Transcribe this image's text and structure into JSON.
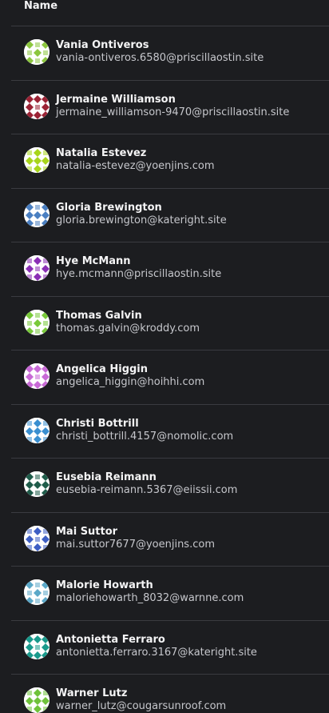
{
  "table": {
    "column_name_header": "Name",
    "users": [
      {
        "name": "Vania Ontiveros",
        "email": "vania-ontiveros.6580@priscillaostin.site",
        "color": "#8cc63f"
      },
      {
        "name": "Jermaine Williamson",
        "email": "jermaine_williamson-9470@priscillaostin.site",
        "color": "#9b2335"
      },
      {
        "name": "Natalia Estevez",
        "email": "natalia-estevez@yoenjins.com",
        "color": "#a8d51a"
      },
      {
        "name": "Gloria Brewington",
        "email": "gloria.brewington@kateright.site",
        "color": "#4a7fc1"
      },
      {
        "name": "Hye McMann",
        "email": "hye.mcmann@priscillaostin.site",
        "color": "#8a2fb5"
      },
      {
        "name": "Thomas Galvin",
        "email": "thomas.galvin@kroddy.com",
        "color": "#79c93a"
      },
      {
        "name": "Angelica Higgin",
        "email": "angelica_higgin@hoihhi.com",
        "color": "#c86ad6"
      },
      {
        "name": "Christi Bottrill",
        "email": "christi_bottrill.4157@nomolic.com",
        "color": "#3a8fd0"
      },
      {
        "name": "Eusebia Reimann",
        "email": "eusebia-reimann.5367@eiissii.com",
        "color": "#1f5c4a"
      },
      {
        "name": "Mai Suttor",
        "email": "mai.suttor7677@yoenjins.com",
        "color": "#3e5fc4"
      },
      {
        "name": "Malorie Howarth",
        "email": "maloriehowarth_8032@warnne.com",
        "color": "#5ba8c8"
      },
      {
        "name": "Antonietta Ferraro",
        "email": "antonietta.ferraro.3167@kateright.site",
        "color": "#1a9a8c"
      },
      {
        "name": "Warner Lutz",
        "email": "warner_lutz@cougarsunroof.com",
        "color": "#6fc23a"
      }
    ]
  }
}
